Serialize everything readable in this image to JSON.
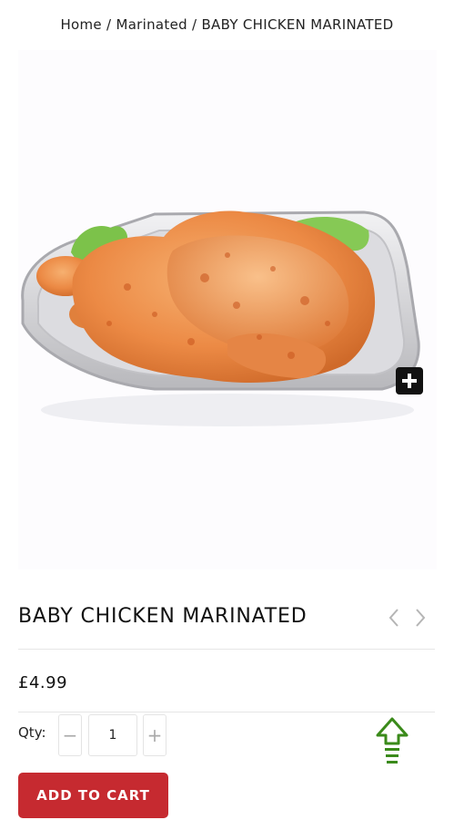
{
  "breadcrumb": {
    "items": [
      "Home",
      "Marinated",
      "BABY CHICKEN MARINATED"
    ],
    "separator": " / "
  },
  "product": {
    "title": "BABY CHICKEN MARINATED",
    "price": "£4.99"
  },
  "quantity": {
    "label": "Qty:",
    "value": "1",
    "minus": "−",
    "plus": "+"
  },
  "actions": {
    "add_to_cart": "ADD TO CART"
  },
  "icons": {
    "zoom": "plus-icon",
    "prev": "chevron-left-icon",
    "next": "chevron-right-icon",
    "scroll_top": "arrow-up-icon"
  },
  "colors": {
    "accent": "#c62a30",
    "scroll_arrow": "#3a8a1a"
  }
}
